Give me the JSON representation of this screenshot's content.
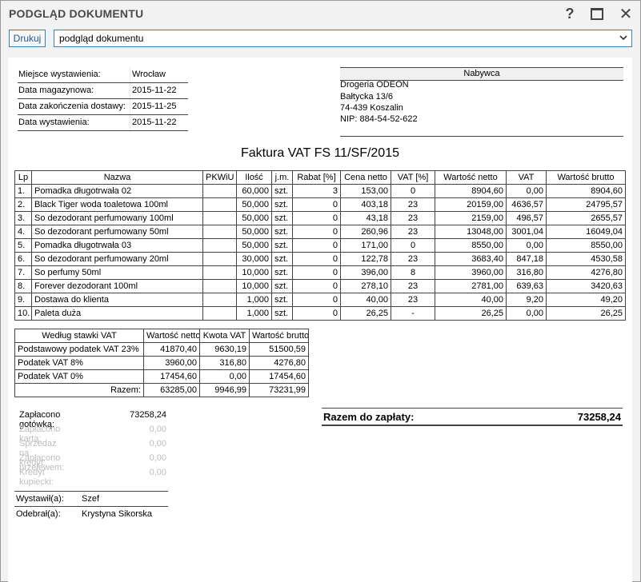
{
  "window": {
    "title": "PODGLĄD DOKUMENTU",
    "help_glyph": "?",
    "close_glyph": "✕"
  },
  "toolbar": {
    "print_label": "Drukuj",
    "view_select_value": "podgląd dokumentu"
  },
  "meta": [
    {
      "label": "Miejsce wystawienia:",
      "value": "Wrocław"
    },
    {
      "label": "Data magazynowa:",
      "value": "2015-11-22"
    },
    {
      "label": "Data zakończenia dostawy:",
      "value": "2015-11-25"
    },
    {
      "label": "Data wystawienia:",
      "value": "2015-11-22"
    }
  ],
  "buyer": {
    "header": "Nabywca",
    "lines": [
      "Drogeria ODEON",
      "Bałtycka 13/6",
      "74-439 Koszalin",
      "NIP: 884-54-52-622"
    ]
  },
  "document_title": "Faktura VAT FS 11/SF/2015",
  "items_table": {
    "headers": [
      "Lp",
      "Nazwa",
      "PKWiU",
      "Ilość",
      "j.m.",
      "Rabat [%]",
      "Cena netto",
      "VAT [%]",
      "Wartość netto",
      "VAT",
      "Wartość brutto"
    ],
    "rows": [
      [
        "1.",
        "Pomadka długotrwała 02",
        "",
        "60,000",
        "szt.",
        "3",
        "153,00",
        "0",
        "8904,60",
        "0,00",
        "8904,60"
      ],
      [
        "2.",
        "Black Tiger woda toaletowa 100ml",
        "",
        "50,000",
        "szt.",
        "0",
        "403,18",
        "23",
        "20159,00",
        "4636,57",
        "24795,57"
      ],
      [
        "3.",
        "So dezodorant perfumowany 100ml",
        "",
        "50,000",
        "szt.",
        "0",
        "43,18",
        "23",
        "2159,00",
        "496,57",
        "2655,57"
      ],
      [
        "4.",
        "So dezodorant perfumowany 50ml",
        "",
        "50,000",
        "szt.",
        "0",
        "260,96",
        "23",
        "13048,00",
        "3001,04",
        "16049,04"
      ],
      [
        "5.",
        "Pomadka długotrwała 03",
        "",
        "50,000",
        "szt.",
        "0",
        "171,00",
        "0",
        "8550,00",
        "0,00",
        "8550,00"
      ],
      [
        "6.",
        "So dezodorant perfumowany 20ml",
        "",
        "30,000",
        "szt.",
        "0",
        "122,78",
        "23",
        "3683,40",
        "847,18",
        "4530,58"
      ],
      [
        "7.",
        "So perfumy 50ml",
        "",
        "10,000",
        "szt.",
        "0",
        "396,00",
        "8",
        "3960,00",
        "316,80",
        "4276,80"
      ],
      [
        "8.",
        "Forever dezodorant 100ml",
        "",
        "10,000",
        "szt.",
        "0",
        "278,10",
        "23",
        "2781,00",
        "639,63",
        "3420,63"
      ],
      [
        "9.",
        "Dostawa do klienta",
        "",
        "1,000",
        "szt.",
        "0",
        "40,00",
        "23",
        "40,00",
        "9,20",
        "49,20"
      ],
      [
        "10.",
        "Paleta duża",
        "",
        "1,000",
        "szt.",
        "0",
        "26,25",
        "-",
        "26,25",
        "0,00",
        "26,25"
      ]
    ]
  },
  "vat_table": {
    "headers": [
      "Według stawki VAT",
      "Wartość netto",
      "Kwota VAT",
      "Wartość brutto"
    ],
    "rows": [
      [
        "Podstawowy podatek VAT 23%",
        "41870,40",
        "9630,19",
        "51500,59"
      ],
      [
        "Podatek VAT 8%",
        "3960,00",
        "316,80",
        "4276,80"
      ],
      [
        "Podatek VAT 0%",
        "17454,60",
        "0,00",
        "17454,60"
      ]
    ],
    "total": [
      "Razem:",
      "63285,00",
      "9946,99",
      "73231,99"
    ]
  },
  "payments": [
    {
      "label": "Zapłacono gotówką:",
      "value": "73258,24",
      "active": true
    },
    {
      "label": "Zapłacono kartą:",
      "value": "0,00",
      "active": false
    },
    {
      "label": "Sprzedaż na kredyt:",
      "value": "0,00",
      "active": false
    },
    {
      "label": "Zapłacono przelewem:",
      "value": "0,00",
      "active": false
    },
    {
      "label": "Kredyt kupiecki:",
      "value": "0,00",
      "active": false
    }
  ],
  "total_due": {
    "label": "Razem do zapłaty:",
    "value": "73258,24"
  },
  "signatures": [
    {
      "label": "Wystawił(a):",
      "value": "Szef"
    },
    {
      "label": "Odebrał(a):",
      "value": "Krystyna Sikorska"
    }
  ],
  "colors": {
    "accent": "#3c7fb1",
    "accent_text": "#1f5a94",
    "disabled_text": "#bdbdbd"
  }
}
